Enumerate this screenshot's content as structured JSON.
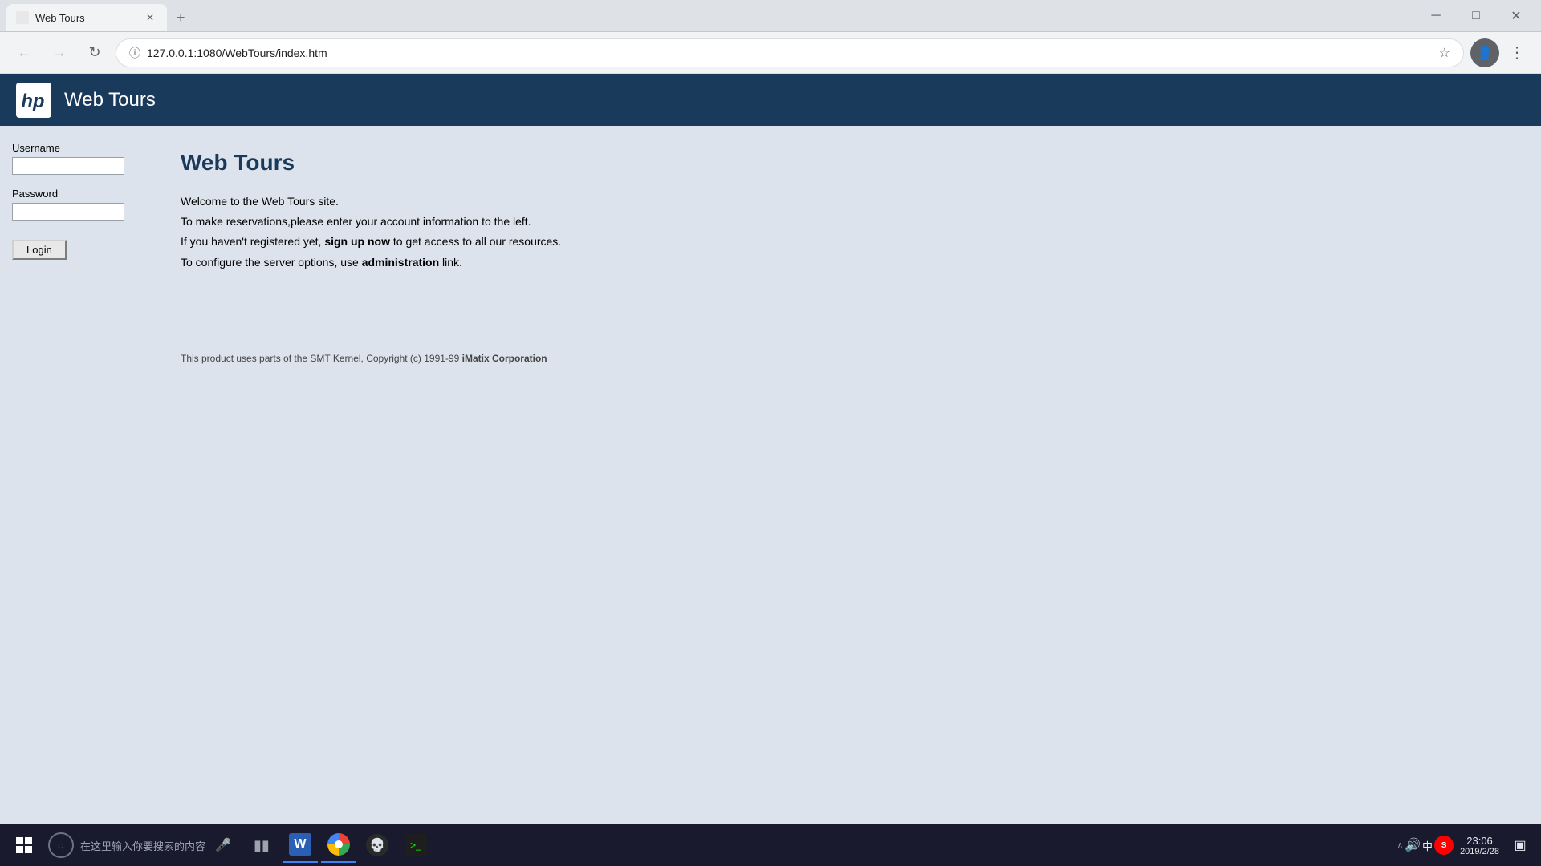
{
  "browser": {
    "tab_title": "Web Tours",
    "tab_favicon": "page-icon",
    "address": "127.0.0.1:1080/WebTours/index.htm",
    "address_protocol_icon": "lock-icon",
    "back_button": "←",
    "forward_button": "→",
    "refresh_button": "↻",
    "bookmark_icon": "☆",
    "profile_icon": "person-icon",
    "menu_icon": "⋮",
    "close_btn": "✕",
    "minimize_btn": "─",
    "maximize_btn": "□"
  },
  "hp_header": {
    "logo_text": "hp",
    "site_title": "Web Tours"
  },
  "sidebar": {
    "username_label": "Username",
    "username_placeholder": "",
    "password_label": "Password",
    "password_placeholder": "",
    "login_button": "Login"
  },
  "main_content": {
    "heading": "Web Tours",
    "line1": "Welcome to the Web Tours site.",
    "line2": "To make reservations,please enter your account information to the left.",
    "line3_prefix": "If you haven't registered yet,",
    "line3_link": "sign up now",
    "line3_suffix": "to get access to all our resources.",
    "line4_prefix": "To configure the server options, use",
    "line4_link": "administration",
    "line4_suffix": "link.",
    "copyright": "This product uses parts of the SMT Kernel, Copyright (c) 1991-99",
    "copyright_company": "iMatix Corporation"
  },
  "taskbar": {
    "search_placeholder": "在这里输入你要搜索的内容",
    "time": "23:06",
    "date": "2019/2/28",
    "sys_chars": "中",
    "notif_arrow": "∧"
  }
}
